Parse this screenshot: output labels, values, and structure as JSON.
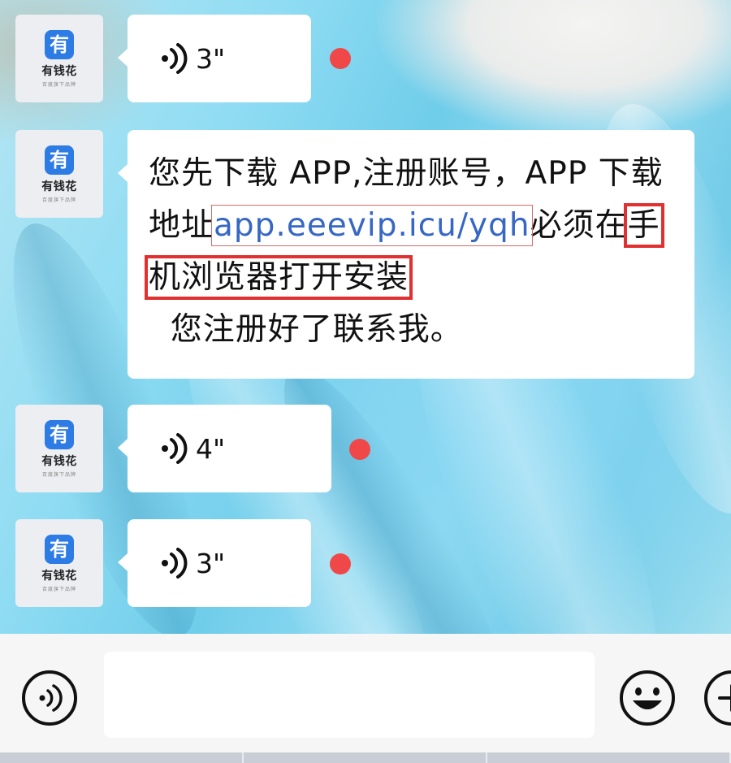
{
  "sender": {
    "app_name": "有钱花",
    "logo_char": "有",
    "tagline": "百度旗下品牌"
  },
  "messages": [
    {
      "type": "voice",
      "duration": "3\"",
      "unread": true
    },
    {
      "type": "text",
      "text_before_link": "您先下载 APP,注册账号，APP 下载地址",
      "link": "app.eeevip.icu/yqh",
      "text_after_link": "必须在",
      "highlighted": "手机浏览器打开安装",
      "text_after_highlight": "  您注册好了联系我。"
    },
    {
      "type": "voice",
      "duration": "4\"",
      "unread": true
    },
    {
      "type": "voice",
      "duration": "3\"",
      "unread": true
    }
  ],
  "input_bar": {
    "voice_button_icon": "voice-icon",
    "emoji_button_icon": "emoji-icon",
    "more_button_icon": "plus-icon",
    "input_value": ""
  },
  "colors": {
    "avatar_logo": "#2d7be4",
    "unread_dot": "#f04848",
    "highlight_box": "#e03030",
    "link": "#3767c4"
  }
}
